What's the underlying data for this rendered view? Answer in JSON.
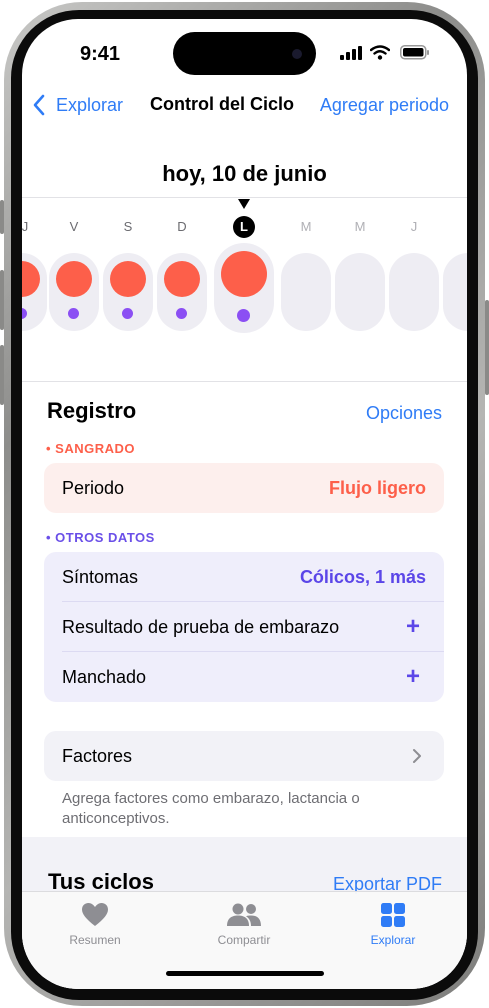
{
  "status": {
    "time": "9:41"
  },
  "nav": {
    "back": "Explorar",
    "title": "Control del Ciclo",
    "action": "Agregar periodo"
  },
  "date_heading": "hoy, 10 de junio",
  "week": {
    "letters": [
      "J",
      "V",
      "S",
      "D",
      "L",
      "M",
      "M",
      "J"
    ],
    "today_letter": "L",
    "days": [
      {
        "flow": true,
        "symptom": true
      },
      {
        "flow": true,
        "symptom": true
      },
      {
        "flow": true,
        "symptom": true
      },
      {
        "flow": true,
        "symptom": true
      },
      {
        "flow": true,
        "symptom": true,
        "today": true
      },
      {
        "flow": false,
        "symptom": false
      },
      {
        "flow": false,
        "symptom": false
      },
      {
        "flow": false,
        "symptom": false
      },
      {
        "flow": false,
        "symptom": false
      }
    ]
  },
  "registro": {
    "title": "Registro",
    "options": "Opciones",
    "bleeding_label": "SANGRADO",
    "period_label": "Periodo",
    "period_value": "Flujo ligero",
    "other_label": "OTROS DATOS",
    "symptoms_label": "Síntomas",
    "symptoms_value": "Cólicos, 1 más",
    "pregnancy_label": "Resultado de prueba de embarazo",
    "spotting_label": "Manchado",
    "factors_label": "Factores",
    "factors_note": "Agrega factores como embarazo, lactancia o anticonceptivos."
  },
  "cycles": {
    "title": "Tus ciclos",
    "export": "Exportar PDF"
  },
  "tabs": [
    {
      "label": "Resumen",
      "icon": "heart-icon",
      "active": false
    },
    {
      "label": "Compartir",
      "icon": "people-icon",
      "active": false
    },
    {
      "label": "Explorar",
      "icon": "grid-icon",
      "active": true
    }
  ],
  "colors": {
    "accent": "#2f7cf6",
    "flow": "#fd5f4a",
    "symptom": "#8b4ff3",
    "bleeding_bg": "#fdefed",
    "other_bg": "#efeefb"
  }
}
